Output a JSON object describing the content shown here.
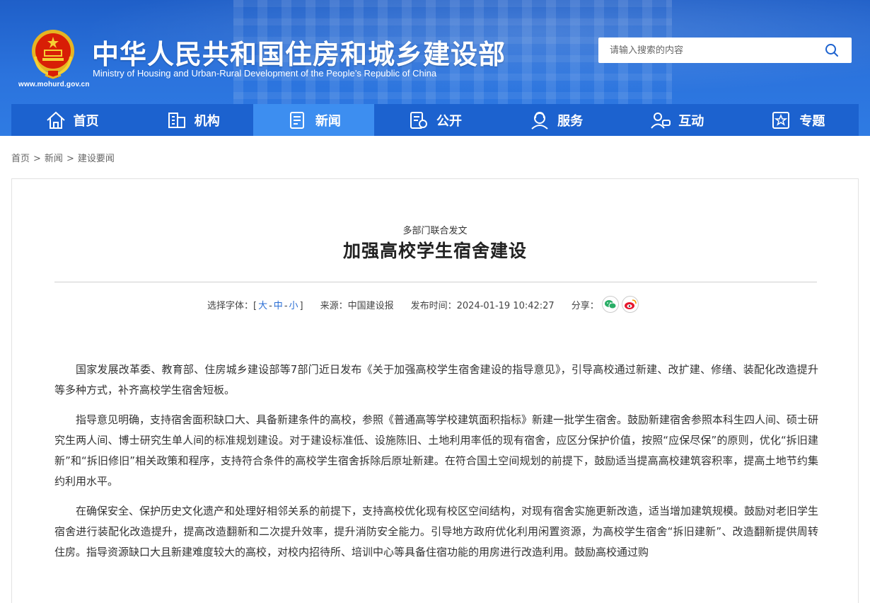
{
  "site": {
    "title": "中华人民共和国住房和城乡建设部",
    "subtitle": "Ministry of Housing and Urban-Rural Development of the People’s Republic of China",
    "url": "www.mohurd.gov.cn"
  },
  "search": {
    "placeholder": "请输入搜索的内容",
    "icon": "search-icon"
  },
  "nav": {
    "items": [
      {
        "label": "首页",
        "icon": "home-icon"
      },
      {
        "label": "机构",
        "icon": "building-icon"
      },
      {
        "label": "新闻",
        "icon": "news-icon",
        "active": true
      },
      {
        "label": "公开",
        "icon": "disclosure-icon"
      },
      {
        "label": "服务",
        "icon": "service-icon"
      },
      {
        "label": "互动",
        "icon": "interaction-icon"
      },
      {
        "label": "专题",
        "icon": "topic-icon"
      }
    ]
  },
  "breadcrumb": {
    "items": [
      "首页",
      "新闻",
      "建设要闻"
    ],
    "separator": ">"
  },
  "article": {
    "kicker": "多部门联合发文",
    "headline": "加强高校学生宿舍建设",
    "meta": {
      "font_label": "选择字体：[",
      "font_large": "大",
      "font_medium": "中",
      "font_small": "小",
      "font_close": "]",
      "dash": "-",
      "source": "来源：中国建设报",
      "published": "发布时间：2024-01-19 10:42:27",
      "share_label": "分享："
    },
    "paragraphs": [
      "国家发展改革委、教育部、住房城乡建设部等7部门近日发布《关于加强高校学生宿舍建设的指导意见》，引导高校通过新建、改扩建、修缮、装配化改造提升等多种方式，补齐高校学生宿舍短板。",
      "指导意见明确，支持宿舍面积缺口大、具备新建条件的高校，参照《普通高等学校建筑面积指标》新建一批学生宿舍。鼓励新建宿舍参照本科生四人间、硕士研究生两人间、博士研究生单人间的标准规划建设。对于建设标准低、设施陈旧、土地利用率低的现有宿舍，应区分保护价值，按照“应保尽保”的原则，优化“拆旧建新”和“拆旧修旧”相关政策和程序，支持符合条件的高校学生宿舍拆除后原址新建。在符合国土空间规划的前提下，鼓励适当提高高校建筑容积率，提高土地节约集约利用水平。",
      "在确保安全、保护历史文化遗产和处理好相邻关系的前提下，支持高校优化现有校区空间结构，对现有宿舍实施更新改造，适当增加建筑规模。鼓励对老旧学生宿舍进行装配化改造提升，提高改造翻新和二次提升效率，提升消防安全能力。引导地方政府优化利用闲置资源，为高校学生宿舍“拆旧建新”、改造翻新提供周转住房。指导资源缺口大且新建难度较大的高校，对校内招待所、培训中心等具备住宿功能的用房进行改造利用。鼓励高校通过购"
    ]
  },
  "colors": {
    "header": "#2b73dd",
    "nav": "#1c62cf",
    "nav_active": "#3d8ef0",
    "link": "#2a6ed4"
  }
}
